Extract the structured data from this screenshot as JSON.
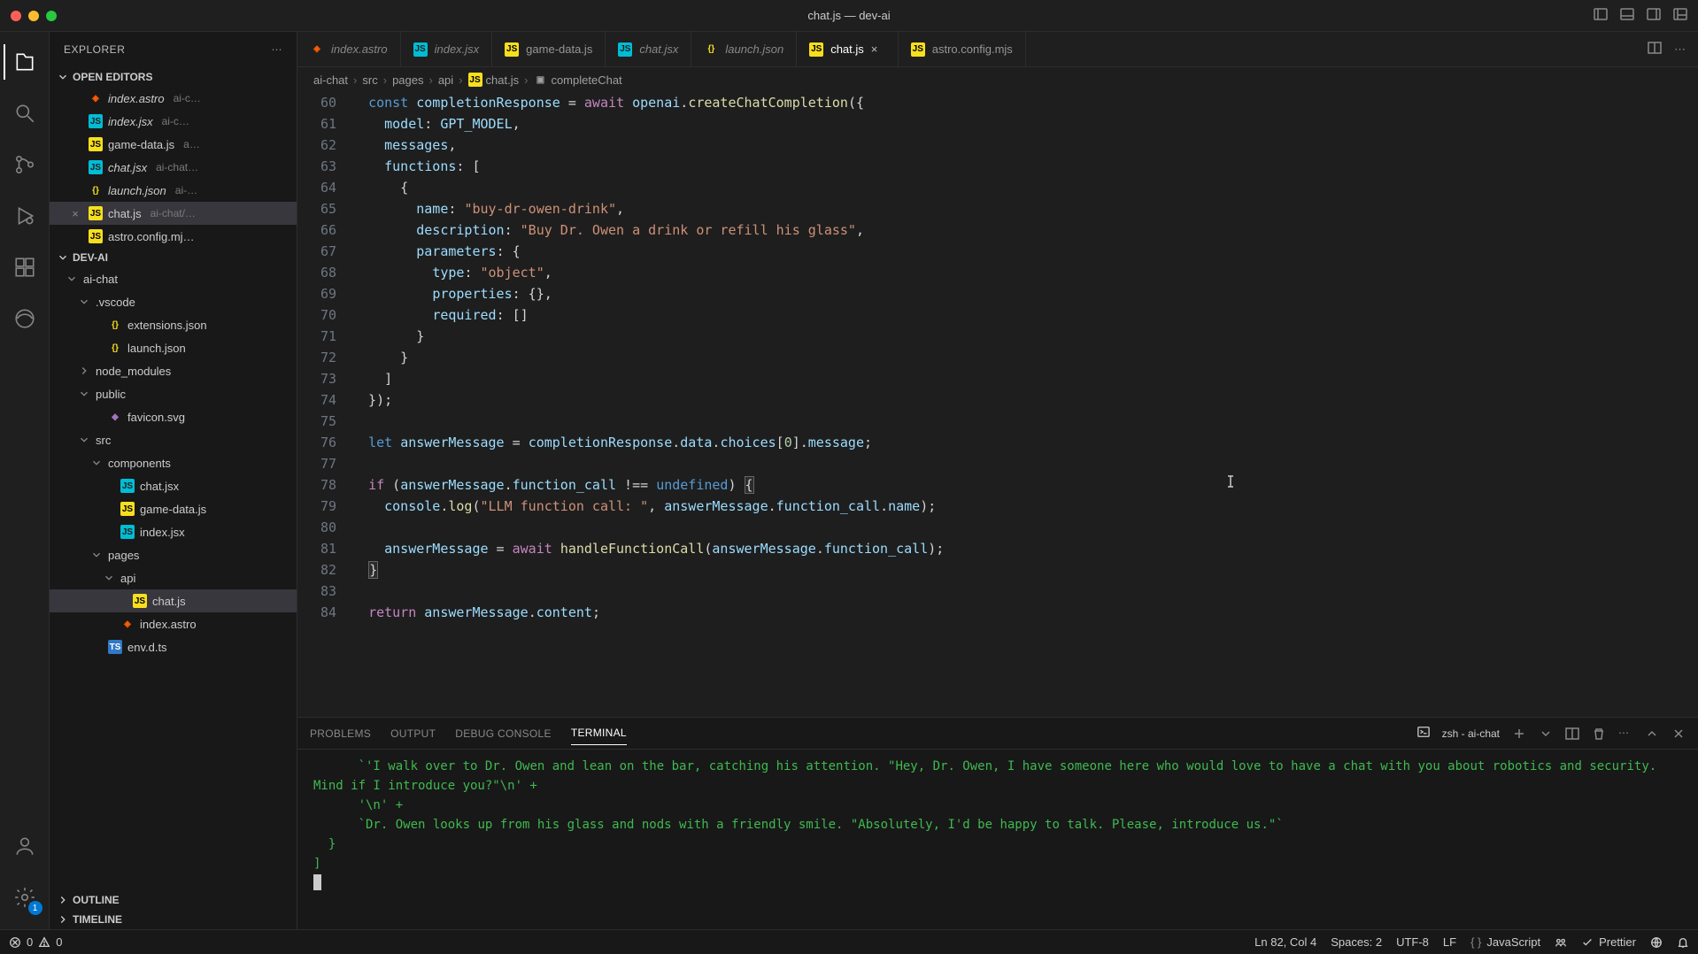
{
  "window": {
    "title": "chat.js — dev-ai"
  },
  "activitybar": {
    "items": [
      {
        "name": "files-icon",
        "active": true
      },
      {
        "name": "search-icon",
        "active": false
      },
      {
        "name": "source-control-icon",
        "active": false
      },
      {
        "name": "debug-icon",
        "active": false
      },
      {
        "name": "extensions-icon",
        "active": false
      },
      {
        "name": "edge-icon",
        "active": false
      }
    ],
    "bottom": [
      {
        "name": "account-icon"
      },
      {
        "name": "settings-gear-icon",
        "badge": "1"
      }
    ]
  },
  "sidebar": {
    "title": "EXPLORER",
    "sections": {
      "openEditors": {
        "label": "OPEN EDITORS",
        "items": [
          {
            "icon": "astro",
            "label": "index.astro",
            "desc": "ai-c…",
            "italic": true
          },
          {
            "icon": "jsx",
            "label": "index.jsx",
            "desc": "ai-c…",
            "italic": true
          },
          {
            "icon": "js",
            "label": "game-data.js",
            "desc": "a…"
          },
          {
            "icon": "jsx",
            "label": "chat.jsx",
            "desc": "ai-chat…",
            "italic": true
          },
          {
            "icon": "json",
            "label": "launch.json",
            "desc": "ai-…",
            "italic": true
          },
          {
            "icon": "js",
            "label": "chat.js",
            "desc": "ai-chat/…",
            "active": true,
            "close": true
          },
          {
            "icon": "js",
            "label": "astro.config.mj…",
            "desc": ""
          }
        ]
      },
      "project": {
        "label": "DEV-AI",
        "tree": [
          {
            "depth": 0,
            "chev": "down",
            "icon": "folder",
            "label": "ai-chat"
          },
          {
            "depth": 1,
            "chev": "down",
            "icon": "folder",
            "label": ".vscode"
          },
          {
            "depth": 2,
            "icon": "json",
            "label": "extensions.json"
          },
          {
            "depth": 2,
            "icon": "json",
            "label": "launch.json"
          },
          {
            "depth": 1,
            "chev": "right",
            "icon": "folder",
            "label": "node_modules"
          },
          {
            "depth": 1,
            "chev": "down",
            "icon": "folder",
            "label": "public"
          },
          {
            "depth": 2,
            "icon": "svg",
            "label": "favicon.svg"
          },
          {
            "depth": 1,
            "chev": "down",
            "icon": "folder",
            "label": "src"
          },
          {
            "depth": 2,
            "chev": "down",
            "icon": "folder",
            "label": "components"
          },
          {
            "depth": 3,
            "icon": "jsx",
            "label": "chat.jsx"
          },
          {
            "depth": 3,
            "icon": "js",
            "label": "game-data.js"
          },
          {
            "depth": 3,
            "icon": "jsx",
            "label": "index.jsx"
          },
          {
            "depth": 2,
            "chev": "down",
            "icon": "folder",
            "label": "pages"
          },
          {
            "depth": 3,
            "chev": "down",
            "icon": "folder",
            "label": "api"
          },
          {
            "depth": 4,
            "icon": "js",
            "label": "chat.js",
            "active": true
          },
          {
            "depth": 3,
            "icon": "astro",
            "label": "index.astro"
          },
          {
            "depth": 2,
            "icon": "ts",
            "label": "env.d.ts"
          }
        ]
      },
      "outline": {
        "label": "OUTLINE"
      },
      "timeline": {
        "label": "TIMELINE"
      }
    }
  },
  "tabs": [
    {
      "icon": "astro",
      "label": "index.astro",
      "italic": true
    },
    {
      "icon": "jsx",
      "label": "index.jsx",
      "italic": true
    },
    {
      "icon": "js",
      "label": "game-data.js"
    },
    {
      "icon": "jsx",
      "label": "chat.jsx",
      "italic": true
    },
    {
      "icon": "json",
      "label": "launch.json",
      "italic": true
    },
    {
      "icon": "js",
      "label": "chat.js",
      "active": true
    },
    {
      "icon": "js",
      "label": "astro.config.mjs"
    }
  ],
  "breadcrumbs": [
    {
      "label": "ai-chat"
    },
    {
      "label": "src"
    },
    {
      "label": "pages"
    },
    {
      "label": "api"
    },
    {
      "icon": "js",
      "label": "chat.js"
    },
    {
      "icon": "symbol",
      "label": "completeChat"
    }
  ],
  "editor": {
    "startLine": 60,
    "lines": [
      {
        "n": 60,
        "tokens": [
          [
            "  ",
            ""
          ],
          [
            "const",
            "const"
          ],
          [
            " ",
            ""
          ],
          [
            "completionResponse",
            "var"
          ],
          [
            " = ",
            ""
          ],
          [
            "await",
            "keyword"
          ],
          [
            " ",
            ""
          ],
          [
            "openai",
            "var"
          ],
          [
            ".",
            ""
          ],
          [
            "createChatCompletion",
            "func"
          ],
          [
            "({",
            ""
          ]
        ]
      },
      {
        "n": 61,
        "tokens": [
          [
            "    ",
            ""
          ],
          [
            "model",
            "prop"
          ],
          [
            ": ",
            ""
          ],
          [
            "GPT_MODEL",
            "var"
          ],
          [
            ",",
            ""
          ]
        ]
      },
      {
        "n": 62,
        "tokens": [
          [
            "    ",
            ""
          ],
          [
            "messages",
            "prop"
          ],
          [
            ",",
            ""
          ]
        ]
      },
      {
        "n": 63,
        "tokens": [
          [
            "    ",
            ""
          ],
          [
            "functions",
            "prop"
          ],
          [
            ": [",
            ""
          ]
        ]
      },
      {
        "n": 64,
        "tokens": [
          [
            "      {",
            ""
          ]
        ]
      },
      {
        "n": 65,
        "tokens": [
          [
            "        ",
            ""
          ],
          [
            "name",
            "prop"
          ],
          [
            ": ",
            ""
          ],
          [
            "\"buy-dr-owen-drink\"",
            "string"
          ],
          [
            ",",
            ""
          ]
        ]
      },
      {
        "n": 66,
        "tokens": [
          [
            "        ",
            ""
          ],
          [
            "description",
            "prop"
          ],
          [
            ": ",
            ""
          ],
          [
            "\"Buy Dr. Owen a drink or refill his glass\"",
            "string"
          ],
          [
            ",",
            ""
          ]
        ]
      },
      {
        "n": 67,
        "tokens": [
          [
            "        ",
            ""
          ],
          [
            "parameters",
            "prop"
          ],
          [
            ": {",
            ""
          ]
        ]
      },
      {
        "n": 68,
        "tokens": [
          [
            "          ",
            ""
          ],
          [
            "type",
            "prop"
          ],
          [
            ": ",
            ""
          ],
          [
            "\"object\"",
            "string"
          ],
          [
            ",",
            ""
          ]
        ]
      },
      {
        "n": 69,
        "tokens": [
          [
            "          ",
            ""
          ],
          [
            "properties",
            "prop"
          ],
          [
            ": {},",
            ""
          ]
        ]
      },
      {
        "n": 70,
        "tokens": [
          [
            "          ",
            ""
          ],
          [
            "required",
            "prop"
          ],
          [
            ": []",
            ""
          ]
        ]
      },
      {
        "n": 71,
        "tokens": [
          [
            "        }",
            ""
          ]
        ]
      },
      {
        "n": 72,
        "tokens": [
          [
            "      }",
            ""
          ]
        ]
      },
      {
        "n": 73,
        "tokens": [
          [
            "    ]",
            ""
          ]
        ]
      },
      {
        "n": 74,
        "tokens": [
          [
            "  });",
            ""
          ]
        ]
      },
      {
        "n": 75,
        "tokens": [
          [
            "",
            ""
          ]
        ]
      },
      {
        "n": 76,
        "tokens": [
          [
            "  ",
            ""
          ],
          [
            "let",
            "const"
          ],
          [
            " ",
            ""
          ],
          [
            "answerMessage",
            "var"
          ],
          [
            " = ",
            ""
          ],
          [
            "completionResponse",
            "var"
          ],
          [
            ".",
            ""
          ],
          [
            "data",
            "prop"
          ],
          [
            ".",
            ""
          ],
          [
            "choices",
            "prop"
          ],
          [
            "[",
            ""
          ],
          [
            "0",
            "num"
          ],
          [
            "].",
            ""
          ],
          [
            "message",
            "prop"
          ],
          [
            ";",
            ""
          ]
        ]
      },
      {
        "n": 77,
        "tokens": [
          [
            "",
            ""
          ]
        ]
      },
      {
        "n": 78,
        "tokens": [
          [
            "  ",
            ""
          ],
          [
            "if",
            "keyword"
          ],
          [
            " (",
            ""
          ],
          [
            "answerMessage",
            "var"
          ],
          [
            ".",
            ""
          ],
          [
            "function_call",
            "prop"
          ],
          [
            " !== ",
            ""
          ],
          [
            "undefined",
            "undefined"
          ],
          [
            ") ",
            ""
          ],
          [
            "{",
            "bracket-highlight"
          ]
        ]
      },
      {
        "n": 79,
        "tokens": [
          [
            "    ",
            ""
          ],
          [
            "console",
            "var"
          ],
          [
            ".",
            ""
          ],
          [
            "log",
            "func"
          ],
          [
            "(",
            ""
          ],
          [
            "\"LLM function call: \"",
            "string"
          ],
          [
            ", ",
            ""
          ],
          [
            "answerMessage",
            "var"
          ],
          [
            ".",
            ""
          ],
          [
            "function_call",
            "prop"
          ],
          [
            ".",
            ""
          ],
          [
            "name",
            "prop"
          ],
          [
            ");",
            ""
          ]
        ]
      },
      {
        "n": 80,
        "tokens": [
          [
            "",
            ""
          ]
        ]
      },
      {
        "n": 81,
        "tokens": [
          [
            "    ",
            ""
          ],
          [
            "answerMessage",
            "var"
          ],
          [
            " = ",
            ""
          ],
          [
            "await",
            "keyword"
          ],
          [
            " ",
            ""
          ],
          [
            "handleFunctionCall",
            "func"
          ],
          [
            "(",
            ""
          ],
          [
            "answerMessage",
            "var"
          ],
          [
            ".",
            ""
          ],
          [
            "function_call",
            "prop"
          ],
          [
            ");",
            ""
          ]
        ]
      },
      {
        "n": 82,
        "tokens": [
          [
            "  ",
            ""
          ],
          [
            "}",
            "bracket-highlight"
          ]
        ]
      },
      {
        "n": 83,
        "tokens": [
          [
            "",
            ""
          ]
        ]
      },
      {
        "n": 84,
        "tokens": [
          [
            "  ",
            ""
          ],
          [
            "return",
            "keyword"
          ],
          [
            " ",
            ""
          ],
          [
            "answerMessage",
            "var"
          ],
          [
            ".",
            ""
          ],
          [
            "content",
            "prop"
          ],
          [
            ";",
            ""
          ]
        ]
      }
    ]
  },
  "panel": {
    "tabs": [
      {
        "label": "PROBLEMS"
      },
      {
        "label": "OUTPUT"
      },
      {
        "label": "DEBUG CONSOLE"
      },
      {
        "label": "TERMINAL",
        "active": true
      }
    ],
    "shell": "zsh - ai-chat",
    "terminal": {
      "lines": [
        "      `'I walk over to Dr. Owen and lean on the bar, catching his attention. \"Hey, Dr. Owen, I have someone here who would love to have a chat with you about robotics and security. Mind if I introduce you?\"\\n' +",
        "      '\\n' +",
        "      `Dr. Owen looks up from his glass and nods with a friendly smile. \"Absolutely, I'd be happy to talk. Please, introduce us.\"`",
        "  }",
        "]"
      ]
    }
  },
  "statusbar": {
    "errors": "0",
    "warnings": "0",
    "cursor": "Ln 82, Col 4",
    "spaces": "Spaces: 2",
    "encoding": "UTF-8",
    "eol": "LF",
    "language": "JavaScript",
    "prettier": "Prettier"
  }
}
